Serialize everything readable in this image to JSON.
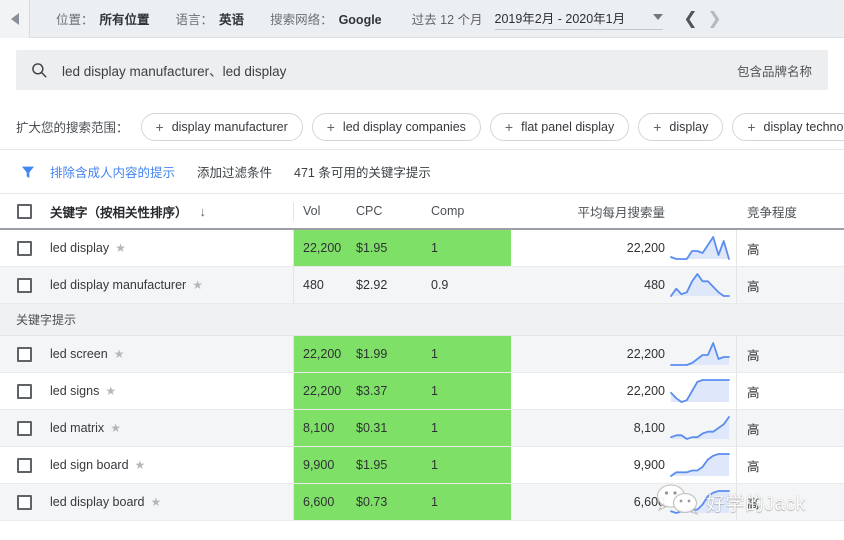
{
  "topbar": {
    "collapse_icon": "collapse-left-arrow-icon",
    "location_label": "位置：",
    "location_value": "所有位置",
    "language_label": "语言：",
    "language_value": "英语",
    "network_label": "搜索网络：",
    "network_value": "Google",
    "period_text": "过去 12 个月",
    "date_range": "2019年2月 - 2020年1月",
    "prev_icon": "chevron-left-icon",
    "next_icon": "chevron-right-icon"
  },
  "search": {
    "icon": "search-icon",
    "query": "led display manufacturer、led display",
    "brand_note": "包含品牌名称"
  },
  "chips": {
    "label": "扩大您的搜索范围：",
    "items": [
      "display manufacturer",
      "led display companies",
      "flat panel display",
      "display",
      "display technology",
      ""
    ]
  },
  "filters": {
    "icon": "filter-funnel-icon",
    "exclude_adult": "排除含成人内容的提示",
    "add_filter": "添加过滤条件",
    "count_text": "471 条可用的关键字提示"
  },
  "table": {
    "headers": {
      "keyword": "关键字（按相关性排序）",
      "sort_icon": "sort-descending-arrow-icon",
      "vol": "Vol",
      "cpc": "CPC",
      "comp": "Comp",
      "avg_monthly": "平均每月搜索量",
      "competition": "竞争程度"
    },
    "section_label": "关键字提示",
    "top_rows": [
      {
        "keyword": "led display",
        "vol": "22,200",
        "cpc": "$1.95",
        "comp": "1",
        "avg": "22,200",
        "competition": "高",
        "highlight": true,
        "spark": "10,8,8,8,16,16,14,22,30,12,26,8"
      },
      {
        "keyword": "led display manufacturer",
        "vol": "480",
        "cpc": "$2.92",
        "comp": "0.9",
        "avg": "480",
        "competition": "高",
        "highlight": false,
        "spark": "6,14,8,10,22,30,22,22,16,10,6,6"
      }
    ],
    "idea_rows": [
      {
        "keyword": "led screen",
        "vol": "22,200",
        "cpc": "$1.99",
        "comp": "1",
        "avg": "22,200",
        "competition": "高",
        "highlight": true,
        "spark": "8,8,8,8,10,14,18,18,30,14,16,16"
      },
      {
        "keyword": "led signs",
        "vol": "22,200",
        "cpc": "$3.37",
        "comp": "1",
        "avg": "22,200",
        "competition": "高",
        "highlight": true,
        "spark": "14,8,4,6,16,26,28,28,28,28,28,28"
      },
      {
        "keyword": "led matrix",
        "vol": "8,100",
        "cpc": "$0.31",
        "comp": "1",
        "avg": "8,100",
        "competition": "高",
        "highlight": true,
        "spark": "8,10,10,6,8,8,12,14,14,18,22,30"
      },
      {
        "keyword": "led sign board",
        "vol": "9,900",
        "cpc": "$1.95",
        "comp": "1",
        "avg": "9,900",
        "competition": "高",
        "highlight": true,
        "spark": "6,10,10,10,12,12,16,24,28,30,30,30"
      },
      {
        "keyword": "led display board",
        "vol": "6,600",
        "cpc": "$0.73",
        "comp": "1",
        "avg": "6,600",
        "competition": "高",
        "highlight": true,
        "spark": "6,4,6,6,8,8,14,24,28,30,30,30"
      }
    ]
  },
  "watermark": {
    "icon": "wechat-icon",
    "text": "好学的Jack"
  },
  "colors": {
    "highlight_green": "#7fe067",
    "link_blue": "#4285f4",
    "spark_line": "#5b8def",
    "topbar_bg": "#eceff1"
  }
}
